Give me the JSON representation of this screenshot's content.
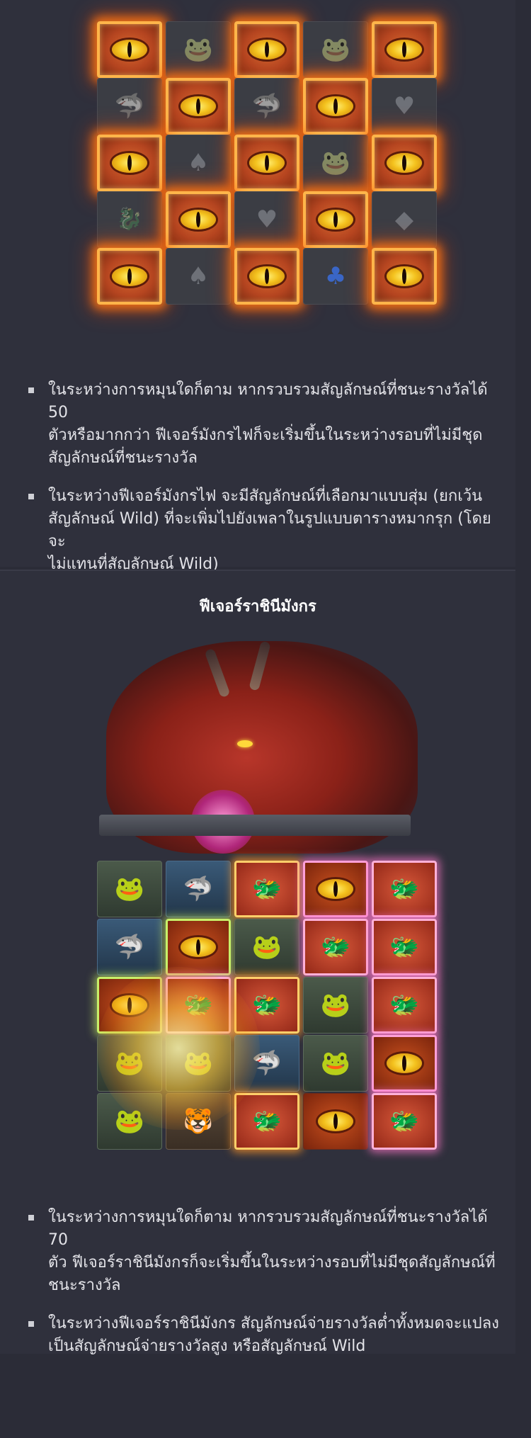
{
  "section1": {
    "grid_cells": [
      [
        "eye",
        "frog",
        "eye",
        "frog",
        "eye"
      ],
      [
        "shark",
        "eye",
        "shark",
        "eye",
        "heart"
      ],
      [
        "eye",
        "spade",
        "eye",
        "frog",
        "eye"
      ],
      [
        "dragon-head",
        "eye",
        "heart",
        "eye",
        "diamond"
      ],
      [
        "eye",
        "spade",
        "eye",
        "club",
        "eye"
      ]
    ],
    "bullets": [
      "ในระหว่างการหมุนใดก็ตาม หากรวบรวมสัญลักษณ์ที่ชนะรางวัลได้ 50\nตัวหรือมากกว่า ฟีเจอร์มังกรไฟก็จะเริ่มขึ้นในระหว่างรอบที่ไม่มีชุด\nสัญลักษณ์ที่ชนะรางวัล",
      "ในระหว่างฟีเจอร์มังกรไฟ จะมีสัญลักษณ์ที่เลือกมาแบบสุ่ม (ยกเว้น\nสัญลักษณ์ Wild) ที่จะเพิ่มไปยังเพลาในรูปแบบตารางหมากรุก (โดยจะ\nไม่แทนที่สัญลักษณ์ Wild)"
    ]
  },
  "section2": {
    "heading": "ฟีเจอร์ราชินีมังกร",
    "grid_cells": [
      [
        "frog",
        "shark",
        "dragon",
        "eye",
        "dragon"
      ],
      [
        "shark",
        "eye",
        "frog",
        "dragon",
        "dragon"
      ],
      [
        "eye",
        "dragon",
        "dragon",
        "frog",
        "dragon"
      ],
      [
        "frog",
        "frog",
        "shark",
        "frog",
        "eye"
      ],
      [
        "frog",
        "tiger",
        "dragon",
        "eye",
        "dragon"
      ]
    ],
    "bullets": [
      "ในระหว่างการหมุนใดก็ตาม หากรวบรวมสัญลักษณ์ที่ชนะรางวัลได้ 70\nตัว ฟีเจอร์ราชินีมังกรก็จะเริ่มขึ้นในระหว่างรอบที่ไม่มีชุดสัญลักษณ์ที่\nชนะรางวัล",
      "ในระหว่างฟีเจอร์ราชินีมังกร สัญลักษณ์จ่ายรางวัลต่ำทั้งหมดจะแปลง\nเป็นสัญลักษณ์จ่ายรางวัลสูง หรือสัญลักษณ์ Wild"
    ]
  },
  "colors": {
    "background": "#2b2c37",
    "panel": "#2f303c",
    "fire_glow": "#ff7814",
    "text": "#e3e3e8",
    "heading": "#ffffff"
  }
}
